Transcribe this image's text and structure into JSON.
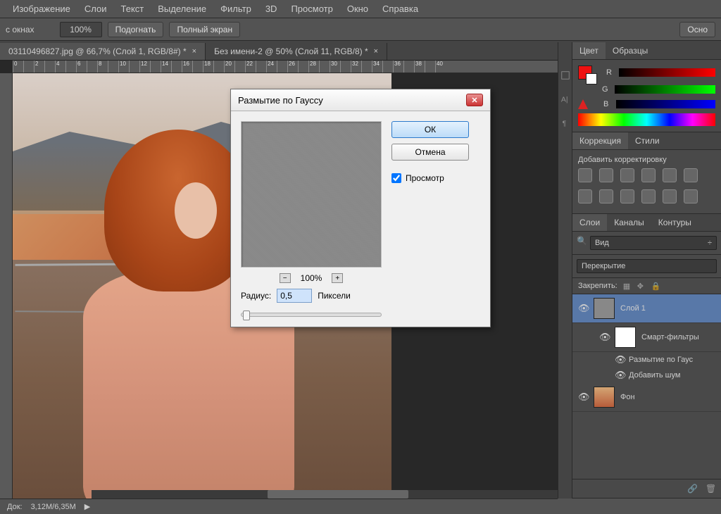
{
  "menu": [
    "Изображение",
    "Слои",
    "Текст",
    "Выделение",
    "Фильтр",
    "3D",
    "Просмотр",
    "Окно",
    "Справка"
  ],
  "options": {
    "windows_label": "с окнах",
    "zoom_pct": "100%",
    "fit_btn": "Подогнать",
    "full_btn": "Полный экран",
    "other_btn": "Осно"
  },
  "tabs": [
    {
      "label": "03110496827.jpg @ 66,7% (Слой 1, RGB/8#) *",
      "active": true
    },
    {
      "label": "Без имени-2 @ 50% (Слой 11, RGB/8) *",
      "active": false
    }
  ],
  "dialog": {
    "title": "Размытие по Гауссу",
    "ok": "ОК",
    "cancel": "Отмена",
    "preview_label": "Просмотр",
    "preview_checked": true,
    "zoom_value": "100%",
    "radius_label": "Радиус:",
    "radius_value": "0,5",
    "radius_unit": "Пиксели"
  },
  "panels": {
    "color": {
      "tab1": "Цвет",
      "tab2": "Образцы",
      "r": "R",
      "g": "G",
      "b": "B"
    },
    "adjustments": {
      "tab1": "Коррекция",
      "tab2": "Стили",
      "add_label": "Добавить корректировку"
    },
    "layers": {
      "tab1": "Слои",
      "tab2": "Каналы",
      "tab3": "Контуры",
      "filter_kind": "Вид",
      "blend_mode": "Перекрытие",
      "lock_label": "Закрепить:",
      "items": [
        {
          "name": "Слой 1",
          "selectable": true,
          "thumb": "gray"
        },
        {
          "name": "Смарт-фильтры",
          "thumb": "white",
          "indent": true
        },
        {
          "name": "Размытие по Гаус",
          "sub": true,
          "eye": true
        },
        {
          "name": "Добавить шум",
          "sub": true,
          "eye": true
        },
        {
          "name": "Фон",
          "thumb": "img"
        }
      ]
    }
  },
  "status": {
    "doc": "Док:",
    "size": "3,12M/6,35M"
  }
}
